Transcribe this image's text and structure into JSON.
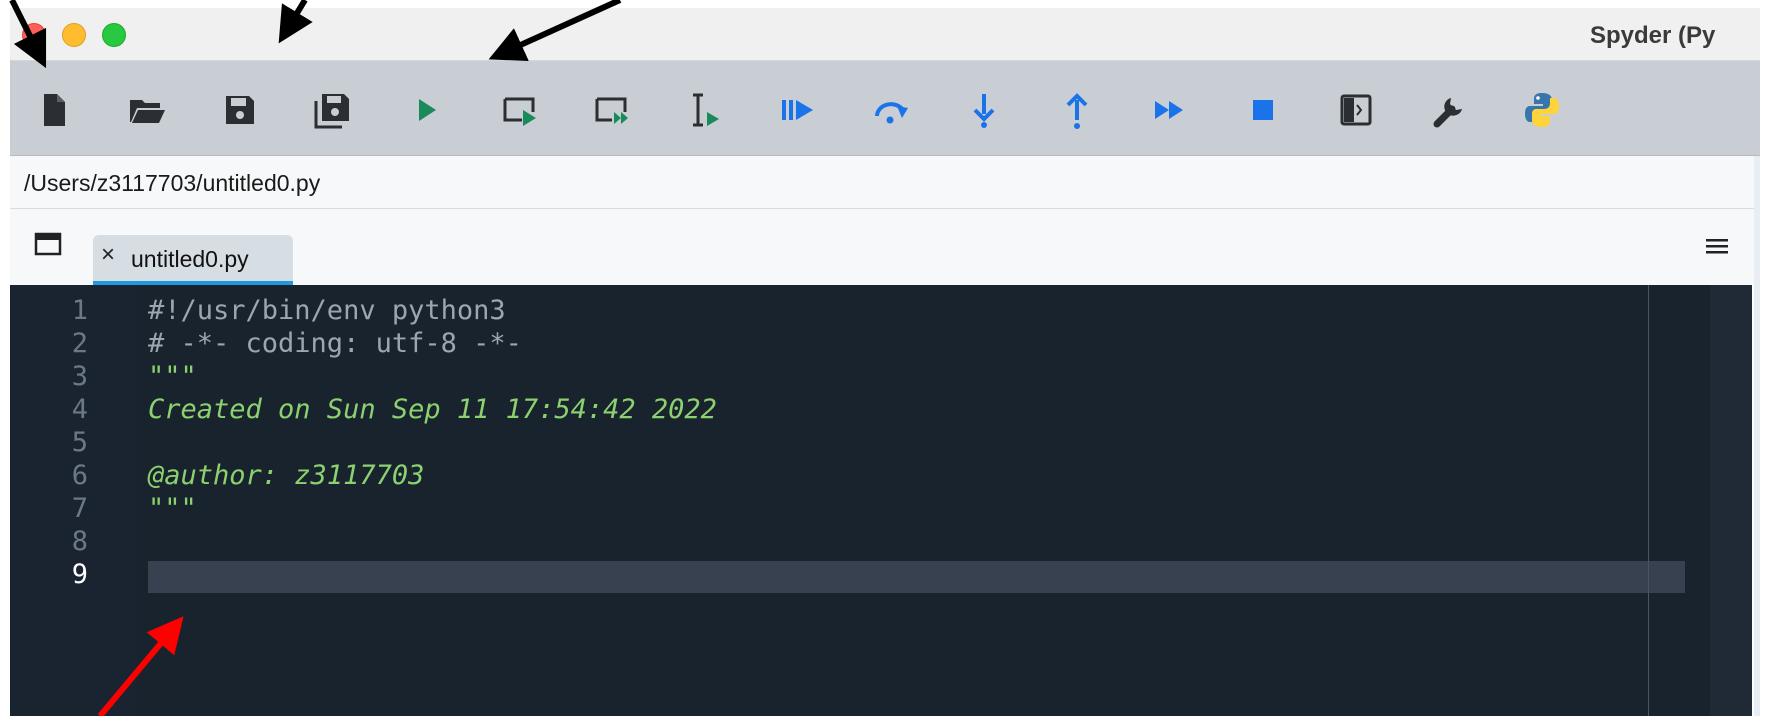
{
  "window": {
    "title": "Spyder (Py"
  },
  "toolbar": {
    "buttons": [
      {
        "name": "new-file-icon",
        "color": "#2b2f33"
      },
      {
        "name": "open-file-icon",
        "color": "#2b2f33"
      },
      {
        "name": "save-icon",
        "color": "#2b2f33"
      },
      {
        "name": "save-all-icon",
        "color": "#2b2f33"
      },
      {
        "name": "run-icon",
        "color": "#1b8a5a"
      },
      {
        "name": "run-cell-icon",
        "color": "#1b8a5a"
      },
      {
        "name": "run-cell-advance-icon",
        "color": "#1b8a5a"
      },
      {
        "name": "run-selection-icon",
        "color": "#1b8a5a"
      },
      {
        "name": "debug-icon",
        "color": "#1a73e8"
      },
      {
        "name": "step-over-icon",
        "color": "#1a73e8"
      },
      {
        "name": "step-into-icon",
        "color": "#1a73e8"
      },
      {
        "name": "step-return-icon",
        "color": "#1a73e8"
      },
      {
        "name": "continue-icon",
        "color": "#1a73e8"
      },
      {
        "name": "stop-debug-icon",
        "color": "#1a73e8"
      },
      {
        "name": "maximize-pane-icon",
        "color": "#2b2f33"
      },
      {
        "name": "preferences-icon",
        "color": "#2b2f33"
      },
      {
        "name": "python-path-icon",
        "color": "#3776ab"
      }
    ]
  },
  "editor": {
    "file_path": "/Users/z3117703/untitled0.py",
    "tab_label": "untitled0.py",
    "tab_close": "×",
    "current_line": 9,
    "lines": [
      {
        "num": "1",
        "text": "#!/usr/bin/env python3",
        "style": "comment"
      },
      {
        "num": "2",
        "text": "# -*- coding: utf-8 -*-",
        "style": "comment"
      },
      {
        "num": "3",
        "text": "\"\"\"",
        "style": "doc"
      },
      {
        "num": "4",
        "text": "Created on Sun Sep 11 17:54:42 2022",
        "style": "doc"
      },
      {
        "num": "5",
        "text": "",
        "style": "doc"
      },
      {
        "num": "6",
        "text": "@author: z3117703",
        "style": "doc"
      },
      {
        "num": "7",
        "text": "\"\"\"",
        "style": "doc"
      },
      {
        "num": "8",
        "text": "",
        "style": "comment"
      },
      {
        "num": "9",
        "text": "",
        "style": "comment"
      }
    ]
  },
  "colors": {
    "editor_bg": "#19232d",
    "comment": "#9ea5ad",
    "docstring": "#8bd16f",
    "tab_indicator": "#1e9ae0",
    "annotation_arrow_black": "#000000",
    "annotation_arrow_red": "#ff0000"
  }
}
